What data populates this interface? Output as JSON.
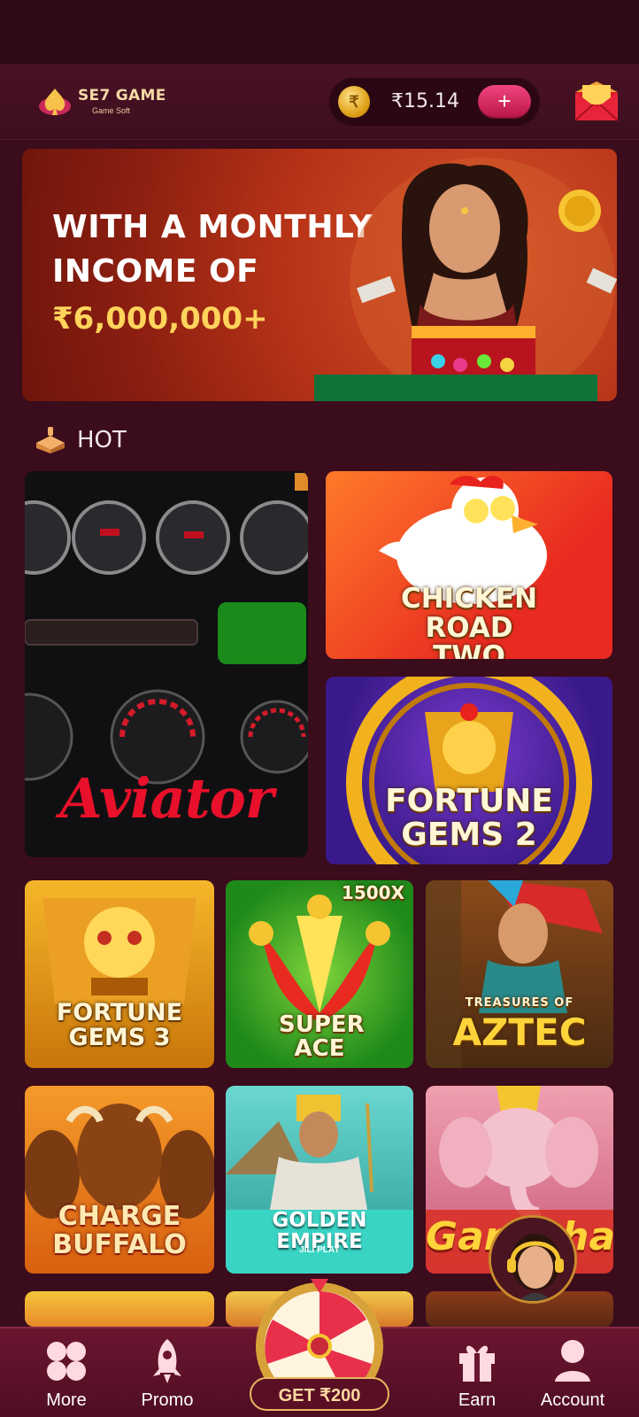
{
  "header": {
    "brand": "SE7 GAME",
    "brand_sub": "Game Soft",
    "currency_icon": "rupee-coin-icon",
    "balance": "₹15.14",
    "add_label": "+",
    "mail_icon": "envelope-icon"
  },
  "banner": {
    "line1": "WITH A MONTHLY",
    "line2": "INCOME OF",
    "amount": "₹6,000,000+"
  },
  "section": {
    "icon": "cake-icon",
    "title": "HOT"
  },
  "games": {
    "aviator": "Aviator",
    "chicken_road": "CHICKEN ROAD TWO",
    "fortune_gems_2": "FORTUNE GEMS 2",
    "fortune_gems_3": "FORTUNE GEMS 3",
    "super_ace": "SUPER ACE",
    "super_ace_badge": "1500X",
    "aztec_small": "TREASURES OF",
    "aztec": "AZTEC",
    "charge_buffalo": "CHARGE BUFFALO",
    "golden_empire": "GOLDEN EMPIRE",
    "golden_empire_sub": "JILI PLAY",
    "ganesha": "Ganesha"
  },
  "nav": {
    "more": "More",
    "promo": "Promo",
    "get": "GET ₹200",
    "earn": "Earn",
    "account": "Account"
  },
  "colors": {
    "background": "#3a0c1c",
    "accent": "#e0306a",
    "gold": "#ffd45c"
  }
}
